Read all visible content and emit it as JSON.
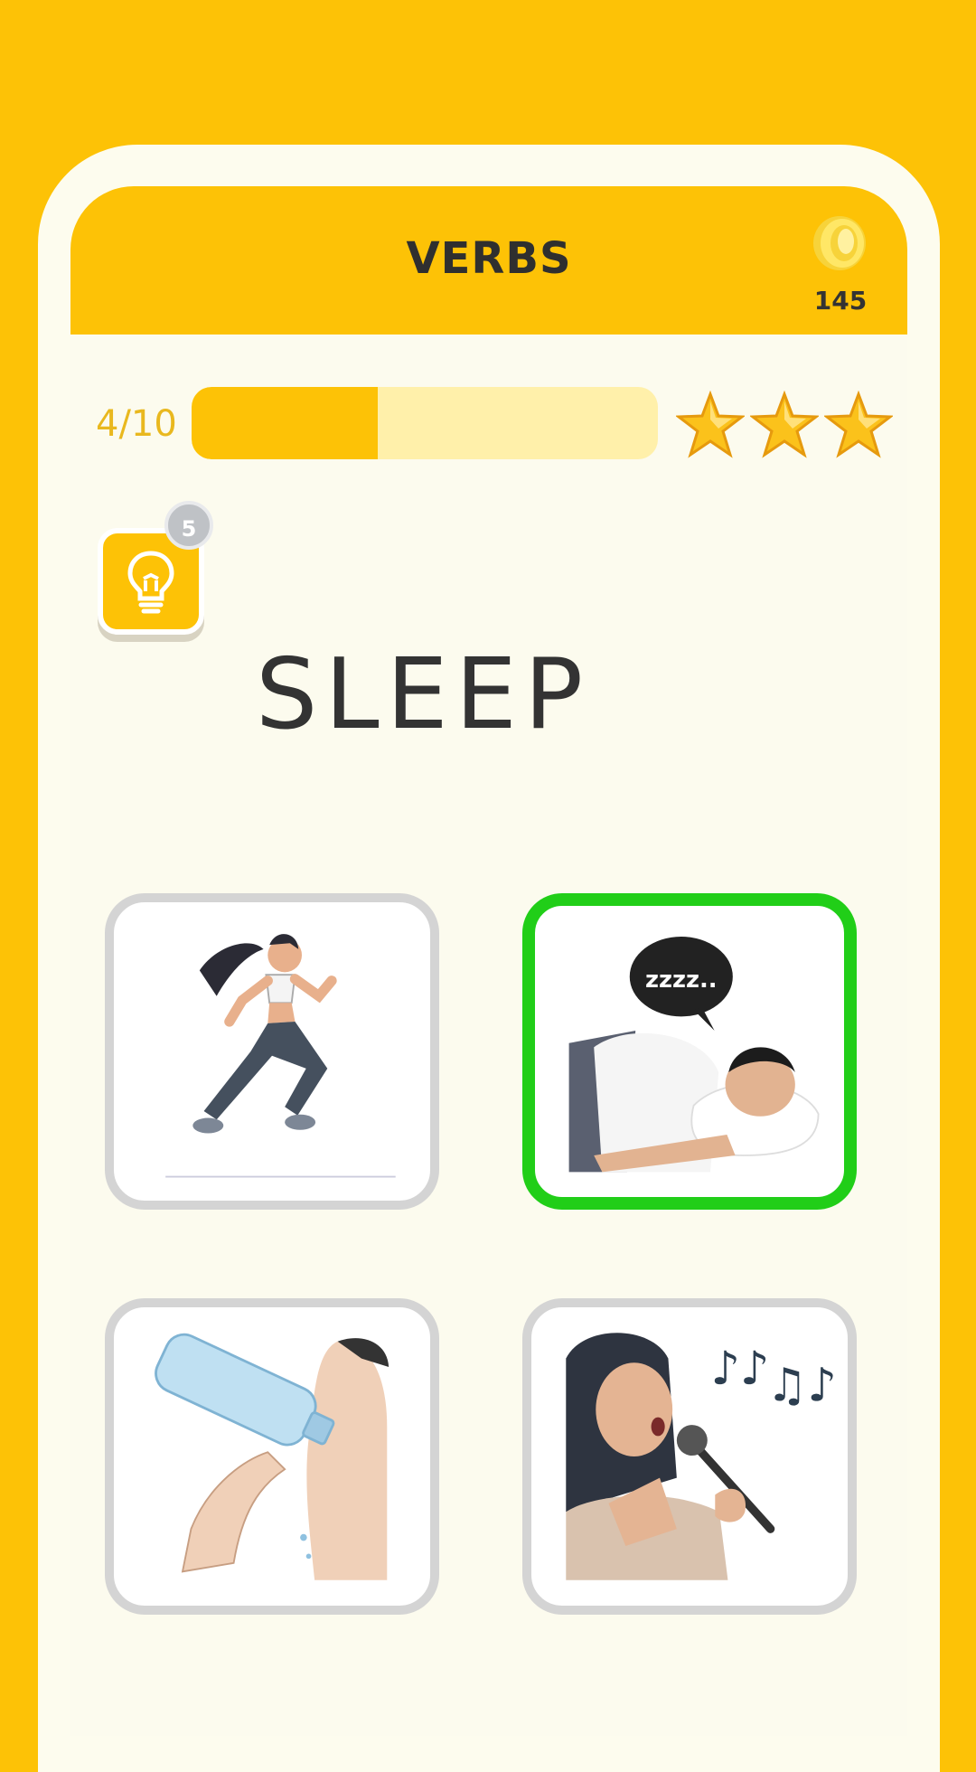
{
  "header": {
    "title": "VERBS",
    "coins": "145",
    "coin_icon": "coin-icon"
  },
  "progress": {
    "label": "4/10",
    "fraction": 0.4,
    "stars": 3
  },
  "hint": {
    "count": "5",
    "icon": "lightbulb-icon"
  },
  "question": {
    "word": "SLEEP"
  },
  "options": [
    {
      "icon": "running-woman-image",
      "state": "neutral"
    },
    {
      "icon": "sleeping-man-image",
      "state": "correct",
      "bubble_text": "zzzz.."
    },
    {
      "icon": "drinking-water-image",
      "state": "neutral"
    },
    {
      "icon": "singing-woman-image",
      "state": "neutral"
    }
  ],
  "colors": {
    "accent": "#FDC206",
    "correct": "#21CE18",
    "background": "#FCFBEE"
  }
}
